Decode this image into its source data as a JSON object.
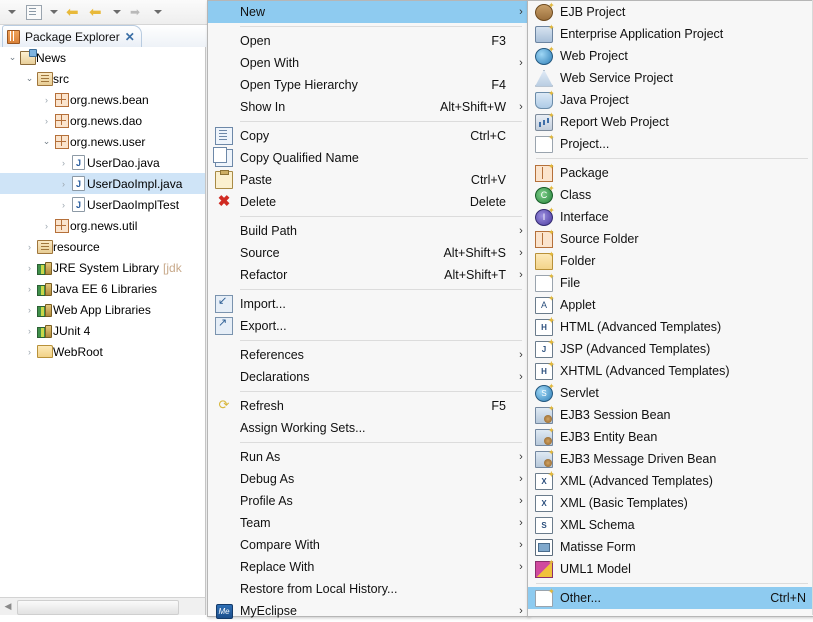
{
  "explorer": {
    "tab_label": "Package Explorer",
    "tab_icon": "package-explorer-icon",
    "close_icon": "close-icon",
    "toolbar": [
      {
        "icon": "chevron-down-icon"
      },
      {
        "icon": "collapse-all-icon"
      },
      {
        "icon": "chevron-down-icon"
      },
      {
        "icon": "back-arrow-icon"
      },
      {
        "icon": "back-arrow-icon"
      },
      {
        "icon": "chevron-down-icon"
      },
      {
        "icon": "forward-arrow-icon"
      },
      {
        "icon": "chevron-down-icon"
      }
    ],
    "tree": [
      {
        "label": "News",
        "indent": 0,
        "twisty": "open",
        "icon": "java-project-icon",
        "selected": false
      },
      {
        "label": "src",
        "indent": 1,
        "twisty": "open",
        "icon": "source-folder-icon",
        "selected": false
      },
      {
        "label": "org.news.bean",
        "indent": 2,
        "twisty": "closed",
        "icon": "package-icon",
        "selected": false
      },
      {
        "label": "org.news.dao",
        "indent": 2,
        "twisty": "closed",
        "icon": "package-icon",
        "selected": false
      },
      {
        "label": "org.news.user",
        "indent": 2,
        "twisty": "open",
        "icon": "package-icon",
        "selected": false
      },
      {
        "label": "UserDao.java",
        "indent": 3,
        "twisty": "closed",
        "icon": "java-file-icon",
        "selected": false
      },
      {
        "label": "UserDaoImpl.java",
        "indent": 3,
        "twisty": "closed",
        "icon": "java-file-icon",
        "selected": true
      },
      {
        "label": "UserDaoImplTest",
        "indent": 3,
        "twisty": "closed",
        "icon": "java-file-icon",
        "selected": false
      },
      {
        "label": "org.news.util",
        "indent": 2,
        "twisty": "closed",
        "icon": "package-icon",
        "selected": false
      },
      {
        "label": "resource",
        "indent": 1,
        "twisty": "closed",
        "icon": "source-folder-icon",
        "selected": false
      },
      {
        "label": "JRE System Library",
        "indent": 1,
        "twisty": "closed",
        "icon": "library-icon",
        "selected": false,
        "suffix": "[jdk"
      },
      {
        "label": "Java EE 6 Libraries",
        "indent": 1,
        "twisty": "closed",
        "icon": "library-icon",
        "selected": false
      },
      {
        "label": "Web App Libraries",
        "indent": 1,
        "twisty": "closed",
        "icon": "library-icon",
        "selected": false
      },
      {
        "label": "JUnit 4",
        "indent": 1,
        "twisty": "closed",
        "icon": "library-icon",
        "selected": false
      },
      {
        "label": "WebRoot",
        "indent": 1,
        "twisty": "closed",
        "icon": "folder-icon",
        "selected": false
      }
    ]
  },
  "context_menu": {
    "highlight_color": "#8ecbf0",
    "items": [
      {
        "label": "New",
        "accel": "",
        "submenu": true,
        "icon": "",
        "highlighted": true
      },
      {
        "sep": true
      },
      {
        "label": "Open",
        "accel": "F3",
        "submenu": false,
        "icon": ""
      },
      {
        "label": "Open With",
        "accel": "",
        "submenu": true,
        "icon": ""
      },
      {
        "label": "Open Type Hierarchy",
        "accel": "F4",
        "submenu": false,
        "icon": ""
      },
      {
        "label": "Show In",
        "accel": "Alt+Shift+W",
        "submenu": true,
        "icon": ""
      },
      {
        "sep": true
      },
      {
        "label": "Copy",
        "accel": "Ctrl+C",
        "submenu": false,
        "icon": "copy-icon"
      },
      {
        "label": "Copy Qualified Name",
        "accel": "",
        "submenu": false,
        "icon": "copy-qualified-name-icon"
      },
      {
        "label": "Paste",
        "accel": "Ctrl+V",
        "submenu": false,
        "icon": "paste-icon"
      },
      {
        "label": "Delete",
        "accel": "Delete",
        "submenu": false,
        "icon": "delete-icon"
      },
      {
        "sep": true
      },
      {
        "label": "Build Path",
        "accel": "",
        "submenu": true,
        "icon": ""
      },
      {
        "label": "Source",
        "accel": "Alt+Shift+S",
        "submenu": true,
        "icon": ""
      },
      {
        "label": "Refactor",
        "accel": "Alt+Shift+T",
        "submenu": true,
        "icon": ""
      },
      {
        "sep": true
      },
      {
        "label": "Import...",
        "accel": "",
        "submenu": false,
        "icon": "import-icon"
      },
      {
        "label": "Export...",
        "accel": "",
        "submenu": false,
        "icon": "export-icon"
      },
      {
        "sep": true
      },
      {
        "label": "References",
        "accel": "",
        "submenu": true,
        "icon": ""
      },
      {
        "label": "Declarations",
        "accel": "",
        "submenu": true,
        "icon": ""
      },
      {
        "sep": true
      },
      {
        "label": "Refresh",
        "accel": "F5",
        "submenu": false,
        "icon": "refresh-icon"
      },
      {
        "label": "Assign Working Sets...",
        "accel": "",
        "submenu": false,
        "icon": ""
      },
      {
        "sep": true
      },
      {
        "label": "Run As",
        "accel": "",
        "submenu": true,
        "icon": ""
      },
      {
        "label": "Debug As",
        "accel": "",
        "submenu": true,
        "icon": ""
      },
      {
        "label": "Profile As",
        "accel": "",
        "submenu": true,
        "icon": ""
      },
      {
        "label": "Team",
        "accel": "",
        "submenu": true,
        "icon": ""
      },
      {
        "label": "Compare With",
        "accel": "",
        "submenu": true,
        "icon": ""
      },
      {
        "label": "Replace With",
        "accel": "",
        "submenu": true,
        "icon": ""
      },
      {
        "label": "Restore from Local History...",
        "accel": "",
        "submenu": false,
        "icon": ""
      },
      {
        "label": "MyEclipse",
        "accel": "",
        "submenu": true,
        "icon": "myeclipse-icon"
      }
    ]
  },
  "new_submenu": {
    "highlight_color": "#8ecbf0",
    "items": [
      {
        "label": "EJB Project",
        "accel": "",
        "icon": "ejb-project-icon"
      },
      {
        "label": "Enterprise Application Project",
        "accel": "",
        "icon": "enterprise-application-project-icon"
      },
      {
        "label": "Web Project",
        "accel": "",
        "icon": "web-project-icon"
      },
      {
        "label": "Web Service Project",
        "accel": "",
        "icon": "web-service-project-icon"
      },
      {
        "label": "Java Project",
        "accel": "",
        "icon": "java-project-icon"
      },
      {
        "label": "Report Web Project",
        "accel": "",
        "icon": "report-web-project-icon"
      },
      {
        "label": "Project...",
        "accel": "",
        "icon": "project-icon"
      },
      {
        "sep": true
      },
      {
        "label": "Package",
        "accel": "",
        "icon": "package-icon"
      },
      {
        "label": "Class",
        "accel": "",
        "icon": "class-icon"
      },
      {
        "label": "Interface",
        "accel": "",
        "icon": "interface-icon"
      },
      {
        "label": "Source Folder",
        "accel": "",
        "icon": "source-folder-icon"
      },
      {
        "label": "Folder",
        "accel": "",
        "icon": "folder-icon"
      },
      {
        "label": "File",
        "accel": "",
        "icon": "file-icon"
      },
      {
        "label": "Applet",
        "accel": "",
        "icon": "applet-icon"
      },
      {
        "label": "HTML (Advanced Templates)",
        "accel": "",
        "icon": "html-icon"
      },
      {
        "label": "JSP (Advanced Templates)",
        "accel": "",
        "icon": "jsp-icon"
      },
      {
        "label": "XHTML (Advanced Templates)",
        "accel": "",
        "icon": "xhtml-icon"
      },
      {
        "label": "Servlet",
        "accel": "",
        "icon": "servlet-icon"
      },
      {
        "label": "EJB3 Session Bean",
        "accel": "",
        "icon": "ejb3-session-bean-icon"
      },
      {
        "label": "EJB3 Entity Bean",
        "accel": "",
        "icon": "ejb3-entity-bean-icon"
      },
      {
        "label": "EJB3 Message Driven Bean",
        "accel": "",
        "icon": "ejb3-message-driven-bean-icon"
      },
      {
        "label": "XML (Advanced Templates)",
        "accel": "",
        "icon": "xml-advanced-icon"
      },
      {
        "label": "XML (Basic Templates)",
        "accel": "",
        "icon": "xml-basic-icon"
      },
      {
        "label": "XML Schema",
        "accel": "",
        "icon": "xml-schema-icon"
      },
      {
        "label": "Matisse Form",
        "accel": "",
        "icon": "matisse-form-icon"
      },
      {
        "label": "UML1 Model",
        "accel": "",
        "icon": "uml1-model-icon"
      },
      {
        "sep": true
      },
      {
        "label": "Other...",
        "accel": "Ctrl+N",
        "icon": "other-icon",
        "highlighted": true
      }
    ]
  }
}
